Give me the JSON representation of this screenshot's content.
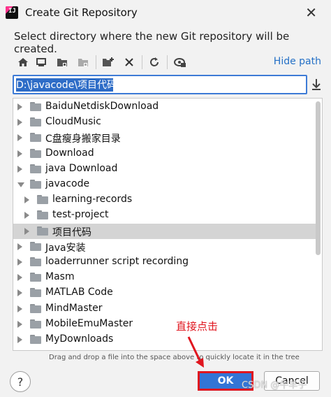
{
  "window": {
    "title": "Create Git Repository",
    "close_glyph": "✕"
  },
  "instruction": "Select directory where the new Git repository will be created.",
  "toolbar": {
    "buttons": [
      {
        "name": "home-icon"
      },
      {
        "name": "desktop-icon"
      },
      {
        "name": "project-folder-icon"
      },
      {
        "name": "module-folder-icon"
      },
      {
        "name": "new-folder-icon"
      },
      {
        "name": "delete-icon"
      },
      {
        "name": "refresh-icon"
      },
      {
        "name": "show-hidden-icon"
      }
    ],
    "hide_path": "Hide path"
  },
  "path_field": {
    "value": "D:\\javacode\\项目代码"
  },
  "tree": {
    "items": [
      {
        "label": "BaiduNetdiskDownload",
        "level": 0,
        "expanded": false,
        "selected": false
      },
      {
        "label": "CloudMusic",
        "level": 0,
        "expanded": false,
        "selected": false
      },
      {
        "label": "C盘瘦身搬家目录",
        "level": 0,
        "expanded": false,
        "selected": false
      },
      {
        "label": "Download",
        "level": 0,
        "expanded": false,
        "selected": false
      },
      {
        "label": "java Download",
        "level": 0,
        "expanded": false,
        "selected": false
      },
      {
        "label": "javacode",
        "level": 0,
        "expanded": true,
        "selected": false
      },
      {
        "label": "learning-records",
        "level": 1,
        "expanded": false,
        "selected": false
      },
      {
        "label": "test-project",
        "level": 1,
        "expanded": false,
        "selected": false
      },
      {
        "label": "项目代码",
        "level": 1,
        "expanded": false,
        "selected": true
      },
      {
        "label": "Java安装",
        "level": 0,
        "expanded": false,
        "selected": false
      },
      {
        "label": "loaderrunner script recording",
        "level": 0,
        "expanded": false,
        "selected": false
      },
      {
        "label": "Masm",
        "level": 0,
        "expanded": false,
        "selected": false
      },
      {
        "label": "MATLAB Code",
        "level": 0,
        "expanded": false,
        "selected": false
      },
      {
        "label": "MindMaster",
        "level": 0,
        "expanded": false,
        "selected": false
      },
      {
        "label": "MobileEmuMaster",
        "level": 0,
        "expanded": false,
        "selected": false
      },
      {
        "label": "MyDownloads",
        "level": 0,
        "expanded": false,
        "selected": false
      }
    ]
  },
  "hint": "Drag and drop a file into the space above to quickly locate it in the tree",
  "footer": {
    "help": "?",
    "ok": "OK",
    "cancel": "Cancel"
  },
  "annotation": {
    "text": "直接点击",
    "color": "#e0161f"
  },
  "watermark": "CSDN @牛羊子",
  "colors": {
    "accent": "#3375d6",
    "link": "#2470c6",
    "selection": "#d4d4d4",
    "highlight_border": "#e0161f"
  }
}
